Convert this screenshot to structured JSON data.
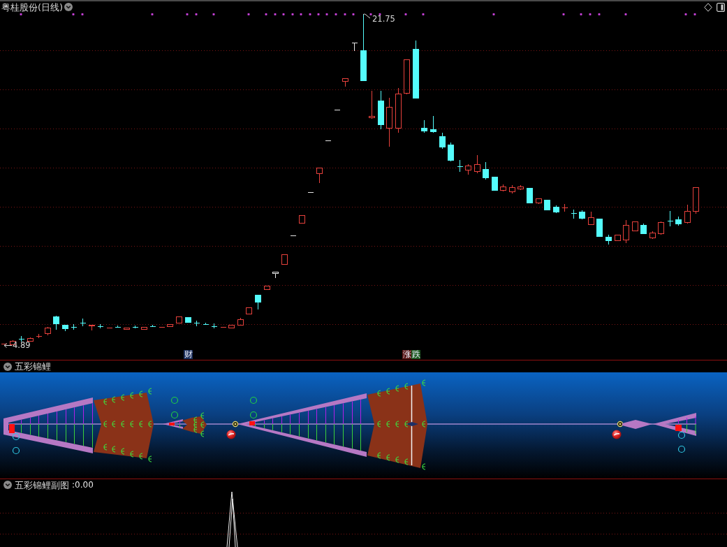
{
  "chart_header": {
    "title": "粤桂股份(日线)"
  },
  "price_chart": {
    "high_label": "21.75",
    "low_label": "4.89",
    "tags": [
      {
        "text": "财",
        "color": "#1c2f5c"
      },
      {
        "text": "涨",
        "color": "#5a1616"
      },
      {
        "text": "跌",
        "color": "#1f5a22"
      }
    ]
  },
  "indicator_panel": {
    "title": "五彩锦鲤"
  },
  "sub_panel": {
    "title": "五彩锦鲤副图",
    "reading": ":0.00"
  }
}
